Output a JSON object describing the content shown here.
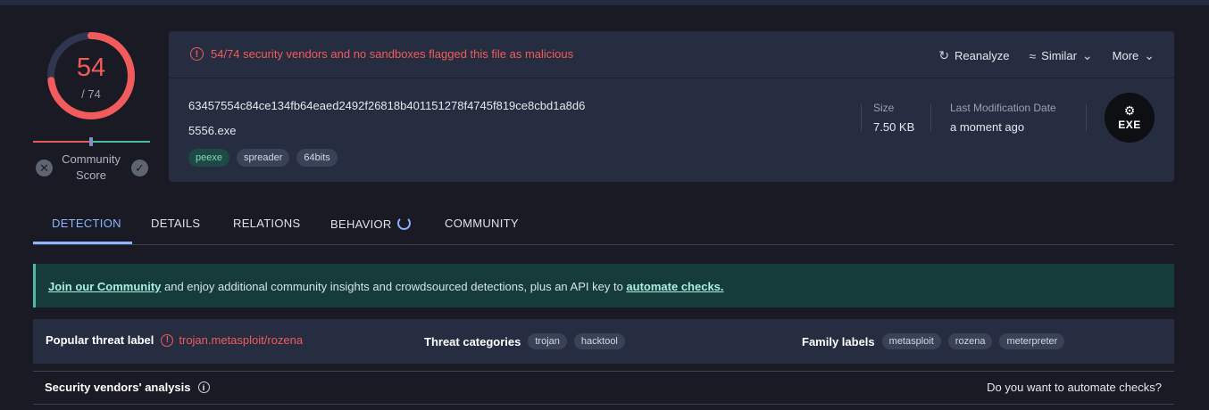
{
  "score": {
    "detected": "54",
    "total": "/ 74",
    "ring_fraction": 0.73,
    "ring_color": "#f15b5b"
  },
  "community": {
    "label": "Community Score"
  },
  "alert": {
    "text": "54/74 security vendors and no sandboxes flagged this file as malicious",
    "color": "#f15b5b"
  },
  "actions": {
    "reanalyze": "Reanalyze",
    "similar": "Similar",
    "more": "More"
  },
  "file": {
    "hash": "63457554c84ce134fb64eaed2492f26818b401151278f4745f819ce8cbd1a8d6",
    "name": "5556.exe",
    "tags": [
      "peexe",
      "spreader",
      "64bits"
    ]
  },
  "meta": {
    "size_label": "Size",
    "size_value": "7.50 KB",
    "mod_label": "Last Modification Date",
    "mod_value": "a moment ago"
  },
  "file_type_badge": "EXE",
  "tabs": [
    "DETECTION",
    "DETAILS",
    "RELATIONS",
    "BEHAVIOR",
    "COMMUNITY"
  ],
  "banner": {
    "link1": "Join our Community",
    "middle": " and enjoy additional community insights and crowdsourced detections, plus an API key to ",
    "link2": "automate checks."
  },
  "threat": {
    "popular_label": "Popular threat label",
    "popular_value": "trojan.metasploit/rozena",
    "categories_label": "Threat categories",
    "categories": [
      "trojan",
      "hacktool"
    ],
    "family_label": "Family labels",
    "families": [
      "metasploit",
      "rozena",
      "meterpreter"
    ]
  },
  "vendors": {
    "label": "Security vendors' analysis",
    "automate": "Do you want to automate checks?"
  }
}
